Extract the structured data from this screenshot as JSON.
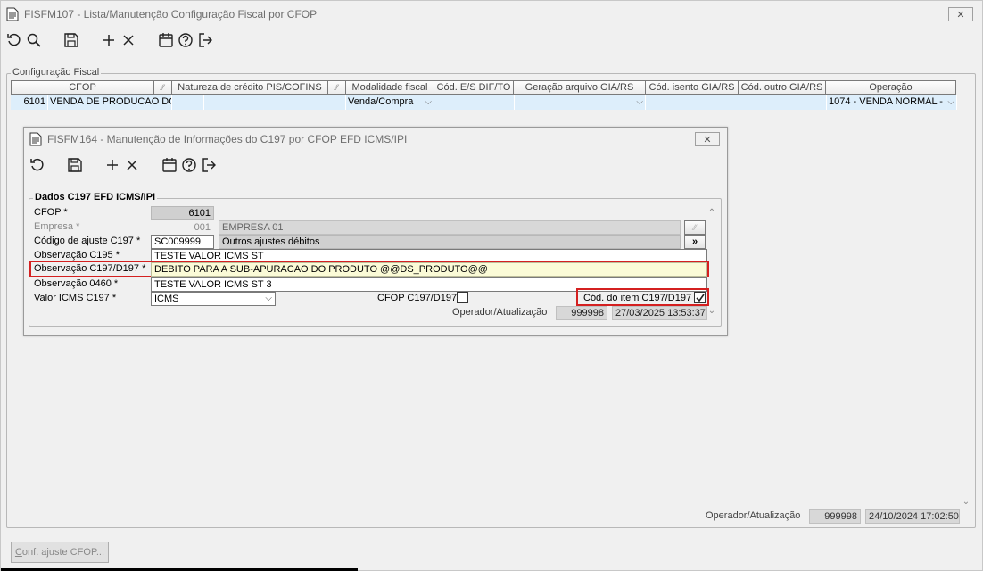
{
  "outer": {
    "title": "FISFM107 - Lista/Manutenção Configuração Fiscal por CFOP",
    "group_title": "Configuração Fiscal",
    "grid": {
      "headers": [
        "CFOP",
        "",
        "Natureza de crédito PIS/COFINS",
        "",
        "Modalidade fiscal",
        "Cód. E/S DIF/TO",
        "Geração arquivo GIA/RS",
        "Cód. isento GIA/RS",
        "Cód. outro GIA/RS",
        "Operação"
      ],
      "row": {
        "cfop": "6101",
        "descricao": "VENDA DE PRODUCAO DO E",
        "modalidade": "Venda/Compra",
        "operacao": "1074 - VENDA NORMAL -"
      }
    },
    "footer": {
      "operador_label": "Operador/Atualização",
      "operador": "999998",
      "data": "24/10/2024 17:02:50"
    },
    "conf_button": "Conf. ajuste CFOP...",
    "conf_button_mnemonic": "C",
    "conf_button_rest": "onf. ajuste CFOP..."
  },
  "inner": {
    "title": "FISFM164 - Manutenção de Informações do C197 por CFOP EFD ICMS/IPI",
    "group_title": "Dados C197 EFD ICMS/IPI",
    "labels": {
      "cfop": "CFOP *",
      "empresa": "Empresa *",
      "codigo_ajuste": "Código de ajuste C197 *",
      "obs_c195": "Observação C195 *",
      "obs_c197": "Observação C197/D197 *",
      "obs_0460": "Observação 0460 *",
      "valor_icms": "Valor ICMS C197 *",
      "cfop_c197": "CFOP C197/D197",
      "cod_item": "Cód. do item C197/D197",
      "operador": "Operador/Atualização"
    },
    "values": {
      "cfop": "6101",
      "empresa_codigo": "001",
      "empresa_nome": "EMPRESA 01",
      "codigo_ajuste": "SC009999",
      "codigo_ajuste_desc": "Outros ajustes débitos",
      "obs_c195": "TESTE VALOR ICMS ST",
      "obs_c197": "DEBITO PARA A SUB-APURACAO DO PRODUTO @@DS_PRODUTO@@",
      "obs_0460": "TESTE VALOR ICMS ST 3",
      "valor_icms": "ICMS",
      "operador": "999998",
      "data": "27/03/2025 13:53:37",
      "lookup_button": "»"
    },
    "checkboxes": {
      "cfop_c197": false,
      "cod_item": true
    }
  },
  "colors": {
    "grid_row_bg": "#ddeefb",
    "highlight_red": "#d42020",
    "yellow_field": "#fbfbd7"
  },
  "icons": [
    "refresh-icon",
    "search-icon",
    "save-icon",
    "add-icon",
    "delete-icon",
    "calendar-icon",
    "help-icon",
    "exit-icon",
    "document-icon",
    "close-icon"
  ]
}
